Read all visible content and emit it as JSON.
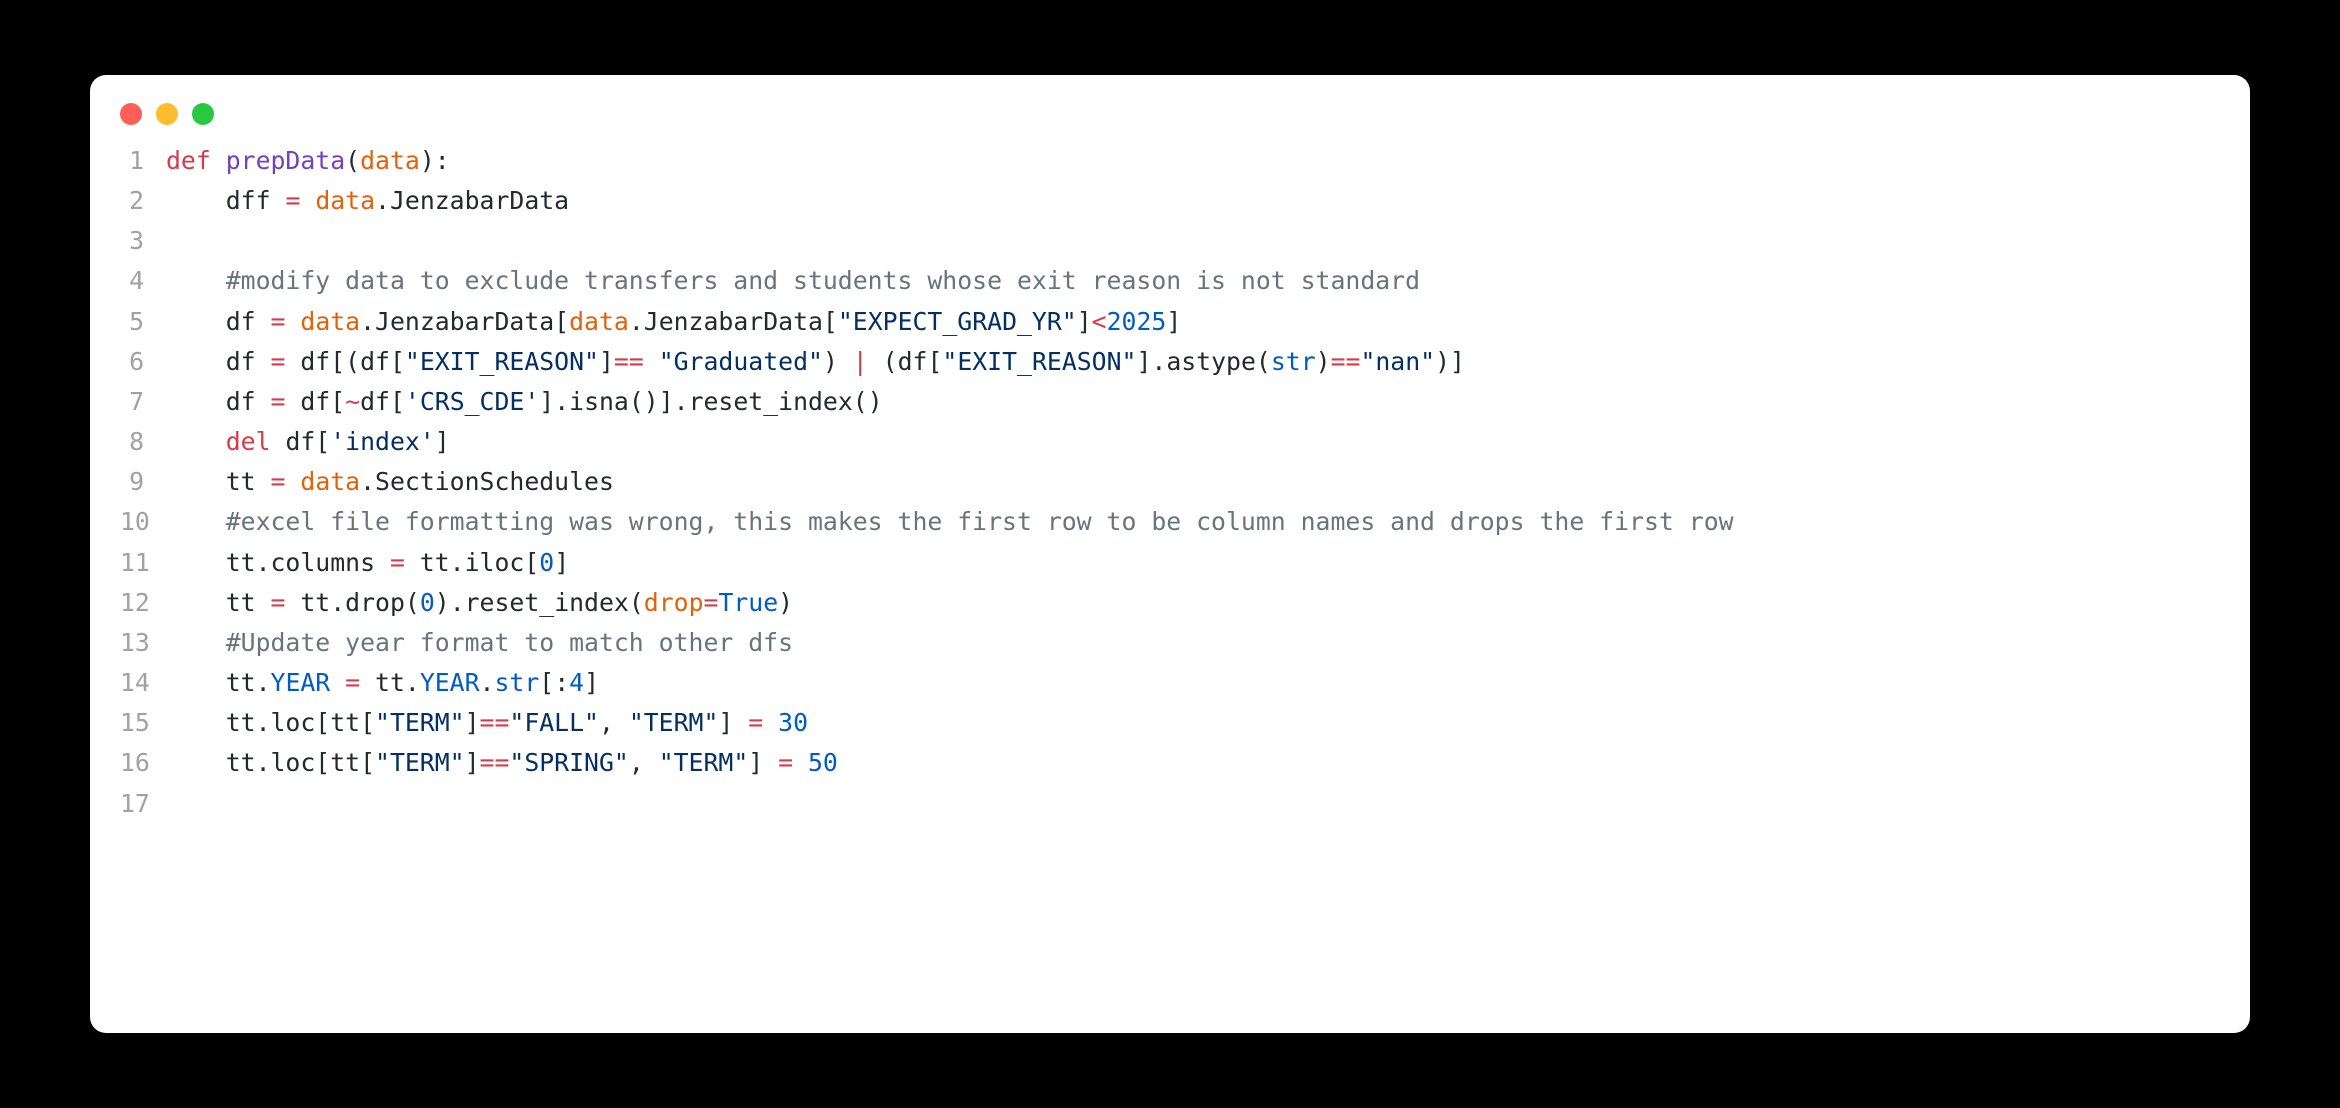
{
  "window": {
    "traffic_lights": [
      "close",
      "minimize",
      "zoom"
    ]
  },
  "code": {
    "language": "python",
    "lines": [
      {
        "num": 1,
        "tokens": [
          {
            "t": "def ",
            "c": "tok-keyword"
          },
          {
            "t": "prepData",
            "c": "tok-def"
          },
          {
            "t": "(",
            "c": "tok-plain"
          },
          {
            "t": "data",
            "c": "tok-param"
          },
          {
            "t": "):",
            "c": "tok-plain"
          }
        ]
      },
      {
        "num": 2,
        "tokens": [
          {
            "t": "    dff ",
            "c": "tok-plain"
          },
          {
            "t": "=",
            "c": "tok-op"
          },
          {
            "t": " ",
            "c": "tok-plain"
          },
          {
            "t": "data",
            "c": "tok-param"
          },
          {
            "t": ".JenzabarData",
            "c": "tok-plain"
          }
        ]
      },
      {
        "num": 3,
        "tokens": []
      },
      {
        "num": 4,
        "tokens": [
          {
            "t": "    ",
            "c": "tok-plain"
          },
          {
            "t": "#modify data to exclude transfers and students whose exit reason is not standard",
            "c": "tok-comment"
          }
        ]
      },
      {
        "num": 5,
        "tokens": [
          {
            "t": "    df ",
            "c": "tok-plain"
          },
          {
            "t": "=",
            "c": "tok-op"
          },
          {
            "t": " ",
            "c": "tok-plain"
          },
          {
            "t": "data",
            "c": "tok-param"
          },
          {
            "t": ".JenzabarData[",
            "c": "tok-plain"
          },
          {
            "t": "data",
            "c": "tok-param"
          },
          {
            "t": ".JenzabarData[",
            "c": "tok-plain"
          },
          {
            "t": "\"EXPECT_GRAD_YR\"",
            "c": "tok-string"
          },
          {
            "t": "]",
            "c": "tok-plain"
          },
          {
            "t": "<",
            "c": "tok-op"
          },
          {
            "t": "2025",
            "c": "tok-number"
          },
          {
            "t": "]",
            "c": "tok-plain"
          }
        ]
      },
      {
        "num": 6,
        "tokens": [
          {
            "t": "    df ",
            "c": "tok-plain"
          },
          {
            "t": "=",
            "c": "tok-op"
          },
          {
            "t": " df[(df[",
            "c": "tok-plain"
          },
          {
            "t": "\"EXIT_REASON\"",
            "c": "tok-string"
          },
          {
            "t": "]",
            "c": "tok-plain"
          },
          {
            "t": "==",
            "c": "tok-op"
          },
          {
            "t": " ",
            "c": "tok-plain"
          },
          {
            "t": "\"Graduated\"",
            "c": "tok-string"
          },
          {
            "t": ") ",
            "c": "tok-plain"
          },
          {
            "t": "|",
            "c": "tok-op"
          },
          {
            "t": " (df[",
            "c": "tok-plain"
          },
          {
            "t": "\"EXIT_REASON\"",
            "c": "tok-string"
          },
          {
            "t": "].astype(",
            "c": "tok-plain"
          },
          {
            "t": "str",
            "c": "tok-builtin"
          },
          {
            "t": ")",
            "c": "tok-plain"
          },
          {
            "t": "==",
            "c": "tok-op"
          },
          {
            "t": "\"nan\"",
            "c": "tok-string"
          },
          {
            "t": ")]",
            "c": "tok-plain"
          }
        ]
      },
      {
        "num": 7,
        "tokens": [
          {
            "t": "    df ",
            "c": "tok-plain"
          },
          {
            "t": "=",
            "c": "tok-op"
          },
          {
            "t": " df[",
            "c": "tok-plain"
          },
          {
            "t": "~",
            "c": "tok-op"
          },
          {
            "t": "df[",
            "c": "tok-plain"
          },
          {
            "t": "'CRS_CDE'",
            "c": "tok-string"
          },
          {
            "t": "].isna()].reset_index()",
            "c": "tok-plain"
          }
        ]
      },
      {
        "num": 8,
        "tokens": [
          {
            "t": "    ",
            "c": "tok-plain"
          },
          {
            "t": "del",
            "c": "tok-keyword"
          },
          {
            "t": " df[",
            "c": "tok-plain"
          },
          {
            "t": "'index'",
            "c": "tok-string"
          },
          {
            "t": "]",
            "c": "tok-plain"
          }
        ]
      },
      {
        "num": 9,
        "tokens": [
          {
            "t": "    tt ",
            "c": "tok-plain"
          },
          {
            "t": "=",
            "c": "tok-op"
          },
          {
            "t": " ",
            "c": "tok-plain"
          },
          {
            "t": "data",
            "c": "tok-param"
          },
          {
            "t": ".SectionSchedules",
            "c": "tok-plain"
          }
        ]
      },
      {
        "num": 10,
        "tokens": [
          {
            "t": "    ",
            "c": "tok-plain"
          },
          {
            "t": "#excel file formatting was wrong, this makes the first row to be column names and drops the first row",
            "c": "tok-comment"
          }
        ]
      },
      {
        "num": 11,
        "tokens": [
          {
            "t": "    tt.columns ",
            "c": "tok-plain"
          },
          {
            "t": "=",
            "c": "tok-op"
          },
          {
            "t": " tt.iloc[",
            "c": "tok-plain"
          },
          {
            "t": "0",
            "c": "tok-number"
          },
          {
            "t": "]",
            "c": "tok-plain"
          }
        ]
      },
      {
        "num": 12,
        "tokens": [
          {
            "t": "    tt ",
            "c": "tok-plain"
          },
          {
            "t": "=",
            "c": "tok-op"
          },
          {
            "t": " tt.drop(",
            "c": "tok-plain"
          },
          {
            "t": "0",
            "c": "tok-number"
          },
          {
            "t": ").reset_index(",
            "c": "tok-plain"
          },
          {
            "t": "drop",
            "c": "tok-param"
          },
          {
            "t": "=",
            "c": "tok-op"
          },
          {
            "t": "True",
            "c": "tok-const"
          },
          {
            "t": ")",
            "c": "tok-plain"
          }
        ]
      },
      {
        "num": 13,
        "tokens": [
          {
            "t": "    ",
            "c": "tok-plain"
          },
          {
            "t": "#Update year format to match other dfs",
            "c": "tok-comment"
          }
        ]
      },
      {
        "num": 14,
        "tokens": [
          {
            "t": "    tt.",
            "c": "tok-plain"
          },
          {
            "t": "YEAR",
            "c": "tok-attr"
          },
          {
            "t": " ",
            "c": "tok-plain"
          },
          {
            "t": "=",
            "c": "tok-op"
          },
          {
            "t": " tt.",
            "c": "tok-plain"
          },
          {
            "t": "YEAR",
            "c": "tok-attr"
          },
          {
            "t": ".",
            "c": "tok-plain"
          },
          {
            "t": "str",
            "c": "tok-builtin"
          },
          {
            "t": "[:",
            "c": "tok-plain"
          },
          {
            "t": "4",
            "c": "tok-number"
          },
          {
            "t": "]",
            "c": "tok-plain"
          }
        ]
      },
      {
        "num": 15,
        "tokens": [
          {
            "t": "    tt.loc[tt[",
            "c": "tok-plain"
          },
          {
            "t": "\"TERM\"",
            "c": "tok-string"
          },
          {
            "t": "]",
            "c": "tok-plain"
          },
          {
            "t": "==",
            "c": "tok-op"
          },
          {
            "t": "\"FALL\"",
            "c": "tok-string"
          },
          {
            "t": ", ",
            "c": "tok-plain"
          },
          {
            "t": "\"TERM\"",
            "c": "tok-string"
          },
          {
            "t": "] ",
            "c": "tok-plain"
          },
          {
            "t": "=",
            "c": "tok-op"
          },
          {
            "t": " ",
            "c": "tok-plain"
          },
          {
            "t": "30",
            "c": "tok-number"
          }
        ]
      },
      {
        "num": 16,
        "tokens": [
          {
            "t": "    tt.loc[tt[",
            "c": "tok-plain"
          },
          {
            "t": "\"TERM\"",
            "c": "tok-string"
          },
          {
            "t": "]",
            "c": "tok-plain"
          },
          {
            "t": "==",
            "c": "tok-op"
          },
          {
            "t": "\"SPRING\"",
            "c": "tok-string"
          },
          {
            "t": ", ",
            "c": "tok-plain"
          },
          {
            "t": "\"TERM\"",
            "c": "tok-string"
          },
          {
            "t": "] ",
            "c": "tok-plain"
          },
          {
            "t": "=",
            "c": "tok-op"
          },
          {
            "t": " ",
            "c": "tok-plain"
          },
          {
            "t": "50",
            "c": "tok-number"
          }
        ]
      },
      {
        "num": 17,
        "tokens": []
      }
    ]
  }
}
